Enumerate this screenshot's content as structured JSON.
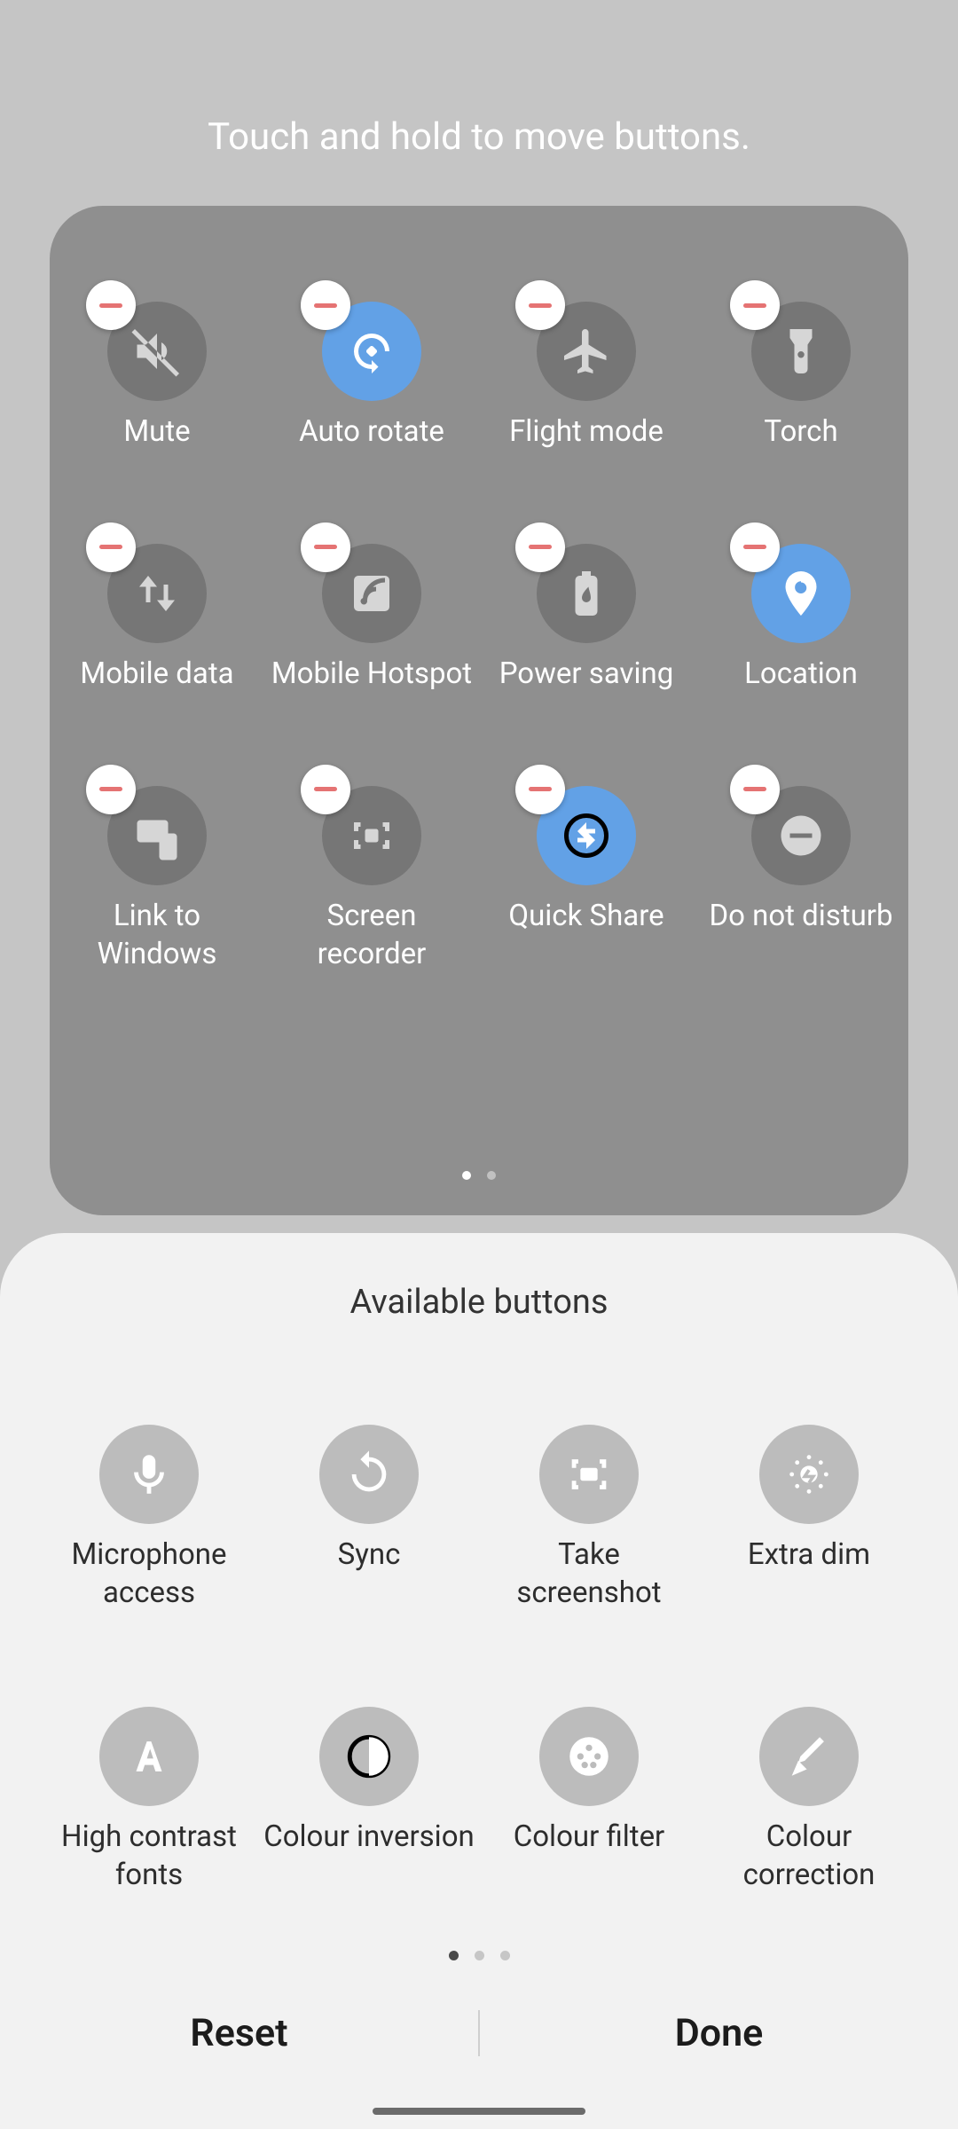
{
  "instruction": "Touch and hold to move buttons.",
  "tiles": [
    {
      "label": "Mute",
      "active": false,
      "icon": "mute"
    },
    {
      "label": "Auto rotate",
      "active": true,
      "icon": "autorotate"
    },
    {
      "label": "Flight mode",
      "active": false,
      "icon": "flight"
    },
    {
      "label": "Torch",
      "active": false,
      "icon": "torch"
    },
    {
      "label": "Mobile data",
      "active": false,
      "icon": "mobiledata"
    },
    {
      "label": "Mobile Hotspot",
      "active": false,
      "icon": "hotspot"
    },
    {
      "label": "Power saving",
      "active": false,
      "icon": "powersave"
    },
    {
      "label": "Location",
      "active": true,
      "icon": "location"
    },
    {
      "label": "Link to Windows",
      "active": false,
      "icon": "linkwindows"
    },
    {
      "label": "Screen recorder",
      "active": false,
      "icon": "screenrec"
    },
    {
      "label": "Quick Share",
      "active": true,
      "icon": "quickshare"
    },
    {
      "label": "Do not disturb",
      "active": false,
      "icon": "dnd"
    }
  ],
  "panel_page": {
    "current": 0,
    "total": 2
  },
  "sheet": {
    "title": "Available buttons",
    "tiles": [
      {
        "label": "Microphone access",
        "icon": "mic"
      },
      {
        "label": "Sync",
        "icon": "sync"
      },
      {
        "label": "Take screenshot",
        "icon": "screenshot"
      },
      {
        "label": "Extra dim",
        "icon": "extradim"
      },
      {
        "label": "High contrast fonts",
        "icon": "hcfont"
      },
      {
        "label": "Colour inversion",
        "icon": "invert"
      },
      {
        "label": "Colour filter",
        "icon": "colourfilter"
      },
      {
        "label": "Colour correction",
        "icon": "colourcorrect"
      }
    ],
    "page": {
      "current": 0,
      "total": 3
    }
  },
  "actions": {
    "reset": "Reset",
    "done": "Done"
  }
}
